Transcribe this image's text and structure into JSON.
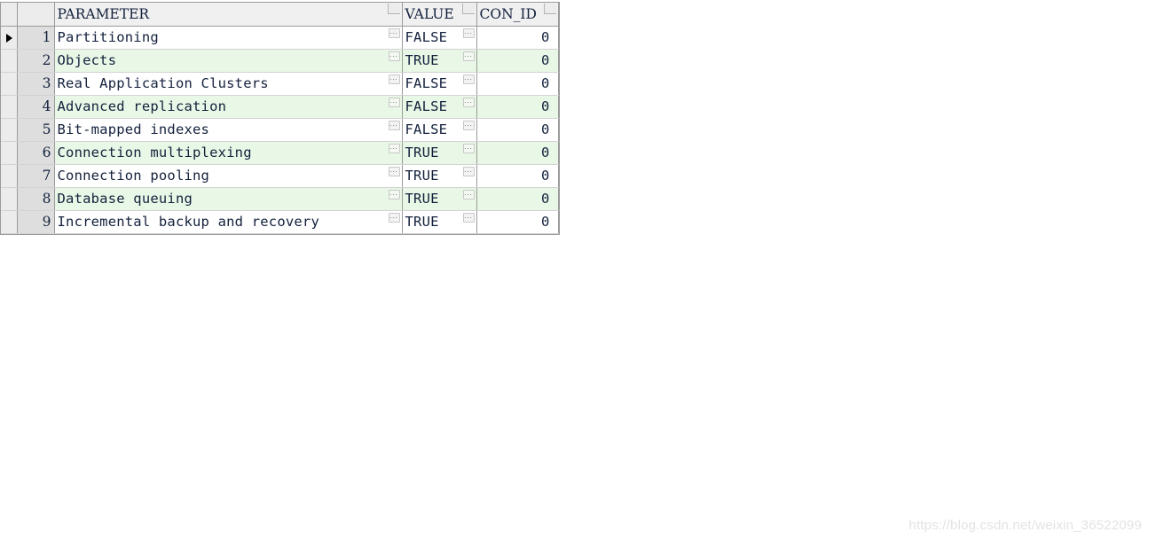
{
  "grid": {
    "name": "database-feature-grid",
    "columns": [
      {
        "key": "marker",
        "label": "",
        "align": "center"
      },
      {
        "key": "rownum",
        "label": "",
        "align": "right"
      },
      {
        "key": "param",
        "label": "PARAMETER",
        "align": "left"
      },
      {
        "key": "value",
        "label": "VALUE",
        "align": "left"
      },
      {
        "key": "conid",
        "label": "CON_ID",
        "align": "right"
      }
    ],
    "ellipsis_button_label": "...",
    "current_row": 1,
    "rows": [
      {
        "num": "1",
        "param": "Partitioning",
        "value": "FALSE",
        "conid": "0"
      },
      {
        "num": "2",
        "param": "Objects",
        "value": "TRUE",
        "conid": "0"
      },
      {
        "num": "3",
        "param": "Real Application Clusters",
        "value": "FALSE",
        "conid": "0"
      },
      {
        "num": "4",
        "param": "Advanced replication",
        "value": "FALSE",
        "conid": "0"
      },
      {
        "num": "5",
        "param": "Bit-mapped indexes",
        "value": "FALSE",
        "conid": "0"
      },
      {
        "num": "6",
        "param": "Connection multiplexing",
        "value": "TRUE",
        "conid": "0"
      },
      {
        "num": "7",
        "param": "Connection pooling",
        "value": "TRUE",
        "conid": "0"
      },
      {
        "num": "8",
        "param": "Database queuing",
        "value": "TRUE",
        "conid": "0"
      },
      {
        "num": "9",
        "param": "Incremental backup and recovery",
        "value": "TRUE",
        "conid": "0"
      }
    ]
  },
  "watermark": {
    "text": "https://blog.csdn.net/weixin_36522099"
  },
  "colors": {
    "header_bg": "#f0f0f0",
    "gutter_bg": "#dedede",
    "row_alt_bg": "#e9f8e6",
    "row_bg": "#ffffff",
    "text": "#14213d",
    "border": "#9a9a9a",
    "watermark": "#e3e3e3"
  }
}
